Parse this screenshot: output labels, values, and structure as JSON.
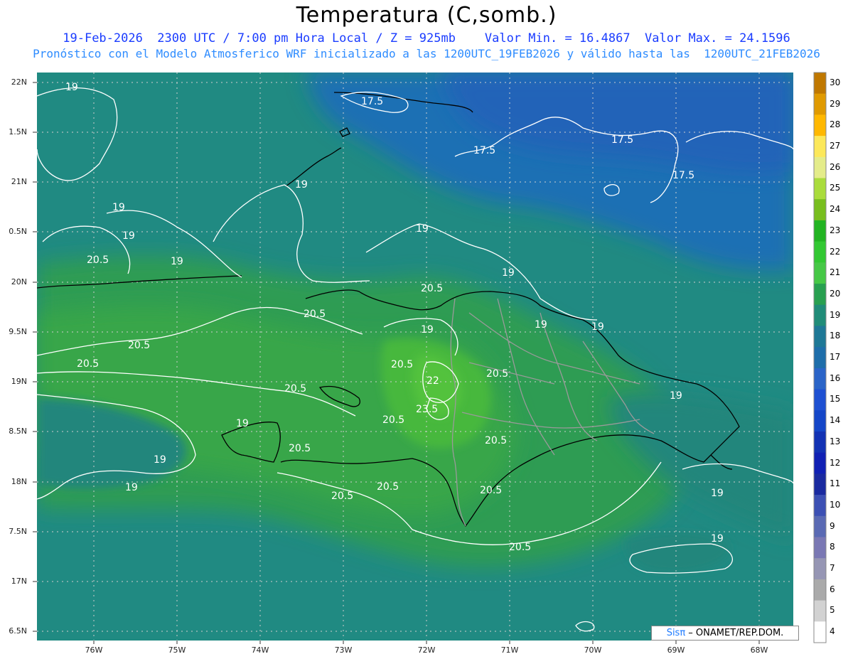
{
  "title": "Temperatura (C,somb.)",
  "subtitle_line1": "19-Feb-2026  2300 UTC / 7:00 pm Hora Local / Z = 925mb    Valor Min. = 16.4867  Valor Max. = 24.1596",
  "subtitle_line2": "Pronóstico con el Modelo Atmosferico WRF inicializado a las 1200UTC_19FEB2026 y válido hasta las  1200UTC_21FEB2026",
  "lat_labels": [
    "22N",
    "1.5N",
    "21N",
    "0.5N",
    "20N",
    "9.5N",
    "19N",
    "8.5N",
    "18N",
    "7.5N",
    "17N",
    "6.5N"
  ],
  "lon_labels": [
    "76W",
    "75W",
    "74W",
    "73W",
    "72W",
    "71W",
    "70W",
    "69W",
    "68W"
  ],
  "colorbar": {
    "labels": [
      "30",
      "29",
      "28",
      "27",
      "26",
      "25",
      "24",
      "23",
      "22",
      "21",
      "20",
      "19",
      "18",
      "17",
      "16",
      "15",
      "14",
      "13",
      "12",
      "11",
      "10",
      "9",
      "8",
      "7",
      "6",
      "5",
      "4"
    ],
    "colors": [
      "#c07800",
      "#e09a00",
      "#ffb800",
      "#fce85a",
      "#e4ec8a",
      "#aadc3c",
      "#78be1e",
      "#22b422",
      "#32c832",
      "#46c846",
      "#28a050",
      "#208c78",
      "#1e7896",
      "#1e6eaa",
      "#2a64c8",
      "#1e50d2",
      "#1446c8",
      "#1232b4",
      "#1020b4",
      "#1a2aa0",
      "#3c50b4",
      "#5a6ab4",
      "#7a78b4",
      "#9696b4",
      "#aaaaaa",
      "#d2d2d2",
      "#ffffff"
    ]
  },
  "contour_labels": [
    "19",
    "17.5",
    "17.5",
    "17.5",
    "17.5",
    "19",
    "19",
    "19",
    "19",
    "20.5",
    "19",
    "19",
    "19",
    "20.5",
    "20.5",
    "20.5",
    "20.5",
    "19",
    "19",
    "20.5",
    "22",
    "20.5",
    "19",
    "23.5",
    "20.5",
    "19",
    "20.5",
    "20.5",
    "20.5",
    "20.5",
    "19",
    "19",
    "19",
    "20.5",
    "20.5",
    "20.5",
    "19",
    "19"
  ],
  "credit": {
    "sis": "Sisπ",
    "rest": " – ONAMET/REP.DOM."
  },
  "colors": {
    "sea_blue": "#1e6fb4",
    "sea_teal": "#208a82",
    "land_green": "#35a44a",
    "peak_green": "#46b83c",
    "contour": "#ffffff",
    "coast": "#000000",
    "border": "#9a9a9a"
  }
}
